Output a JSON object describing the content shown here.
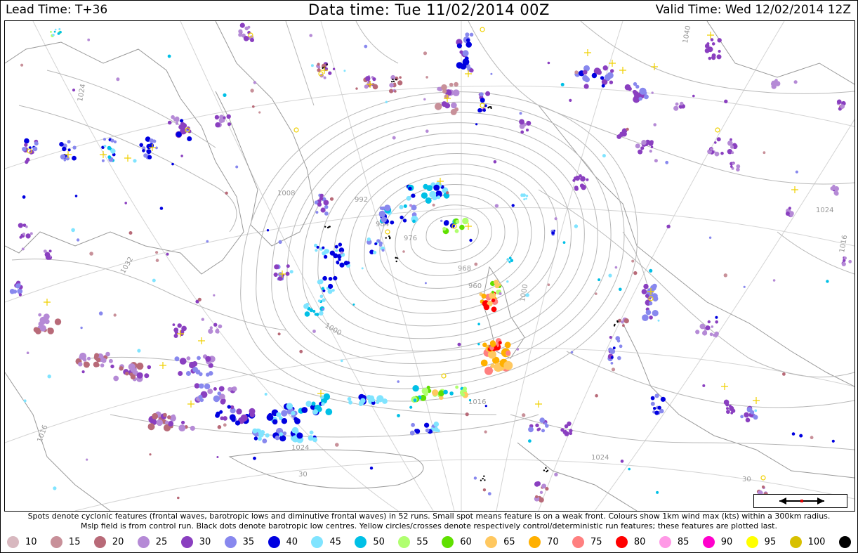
{
  "header": {
    "lead_time": "Lead Time: T+36",
    "data_time": "Data time:  Tue 11/02/2014 00Z",
    "valid_time": "Valid Time: Wed 12/02/2014 12Z"
  },
  "caption": {
    "line1": "Spots denote cyclonic features (frontal waves, barotropic lows and diminutive frontal waves) in 52 runs. Small spot means feature is on a weak front. Colours show 1km wind max (kts) within a 300km radius.",
    "line2": "Mslp field is from control run. Black dots denote barotropic low centres. Yellow circles/crosses denote respectively control/deterministic run features; these features are plotted last."
  },
  "legend": [
    {
      "label": "10",
      "color": "#d8b8bf"
    },
    {
      "label": "15",
      "color": "#c89099"
    },
    {
      "label": "20",
      "color": "#b86a78"
    },
    {
      "label": "25",
      "color": "#b58ad6"
    },
    {
      "label": "30",
      "color": "#8a3fc0"
    },
    {
      "label": "35",
      "color": "#8888ee"
    },
    {
      "label": "40",
      "color": "#0000e0"
    },
    {
      "label": "45",
      "color": "#80e4ff"
    },
    {
      "label": "50",
      "color": "#00c0e6"
    },
    {
      "label": "55",
      "color": "#b0ff70"
    },
    {
      "label": "60",
      "color": "#60e000"
    },
    {
      "label": "65",
      "color": "#ffc860"
    },
    {
      "label": "70",
      "color": "#ffb000"
    },
    {
      "label": "75",
      "color": "#ff8080"
    },
    {
      "label": "80",
      "color": "#ff0000"
    },
    {
      "label": "85",
      "color": "#ff99e6"
    },
    {
      "label": "90",
      "color": "#ff00cc"
    },
    {
      "label": "95",
      "color": "#ffff00"
    },
    {
      "label": "100",
      "color": "#d8c000"
    },
    {
      "label": "",
      "color": "#000000"
    }
  ],
  "isobar_labels": [
    "1016",
    "1024",
    "1032",
    "1008",
    "992",
    "984",
    "976",
    "968",
    "960",
    "1000",
    "1040",
    "1024",
    "1016",
    "1008",
    "1000",
    "1024",
    "1024",
    "1016"
  ],
  "lat_labels": [
    "30",
    "30"
  ]
}
